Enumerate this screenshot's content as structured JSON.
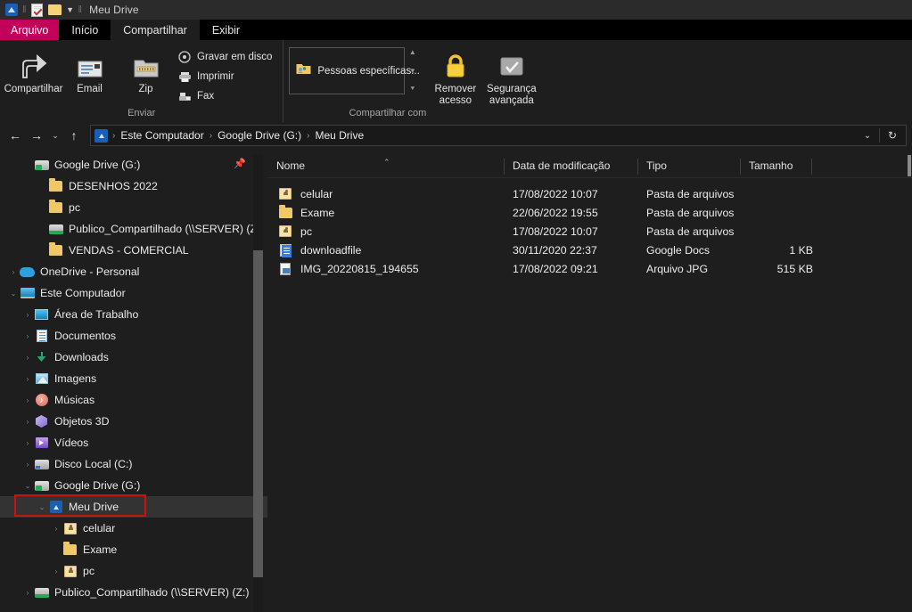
{
  "titlebar": {
    "title": "Meu Drive",
    "icons": [
      "google-drive-icon",
      "properties-icon",
      "new-folder-icon",
      "customize-chevron-icon"
    ]
  },
  "ribbon": {
    "tabs": [
      {
        "label": "Arquivo",
        "state": "file"
      },
      {
        "label": "Início",
        "state": "normal"
      },
      {
        "label": "Compartilhar",
        "state": "active"
      },
      {
        "label": "Exibir",
        "state": "normal"
      }
    ],
    "groups": [
      {
        "caption": "Enviar",
        "big_buttons": [
          {
            "label": "Compartilhar",
            "icon": "share-arrow-icon"
          },
          {
            "label": "Email",
            "icon": "email-icon"
          },
          {
            "label": "Zip",
            "icon": "zip-folder-icon"
          }
        ],
        "small_buttons": [
          {
            "label": "Gravar em disco",
            "icon": "disc-icon"
          },
          {
            "label": "Imprimir",
            "icon": "printer-icon"
          },
          {
            "label": "Fax",
            "icon": "fax-icon"
          }
        ]
      },
      {
        "caption": "Compartilhar com",
        "list_item": {
          "label": "Pessoas específicas...",
          "icon": "shared-folder-icon"
        },
        "big_buttons": [
          {
            "label": "Remover\nacesso",
            "line1": "Remover",
            "line2": "acesso",
            "icon": "lock-icon"
          },
          {
            "label": "Segurança\navançada",
            "line1": "Segurança",
            "line2": "avançada",
            "icon": "security-shield-icon"
          }
        ]
      }
    ]
  },
  "addressbar": {
    "back": "←",
    "forward": "→",
    "recent": "⌄",
    "up": "↑",
    "path_icon": "google-drive-icon",
    "crumbs": [
      "Este Computador",
      "Google Drive (G:)",
      "Meu Drive"
    ],
    "dropdown": "⌄",
    "refresh": "↻"
  },
  "sidebar": {
    "items": [
      {
        "label": "Google Drive (G:)",
        "icon": "gdrive-drive-icon",
        "indent": 1,
        "expander": "",
        "pin": true,
        "selected": false
      },
      {
        "label": "DESENHOS 2022",
        "icon": "folder-icon",
        "indent": 2,
        "expander": "",
        "selected": false
      },
      {
        "label": "pc",
        "icon": "folder-icon",
        "indent": 2,
        "expander": "",
        "selected": false
      },
      {
        "label": "Publico_Compartilhado (\\\\SERVER) (Z:)",
        "icon": "network-drive-icon",
        "indent": 2,
        "expander": "",
        "selected": false
      },
      {
        "label": "VENDAS - COMERCIAL",
        "icon": "folder-icon",
        "indent": 2,
        "expander": "",
        "selected": false
      },
      {
        "label": "OneDrive - Personal",
        "icon": "onedrive-icon",
        "indent": 0,
        "expander": "›",
        "selected": false
      },
      {
        "label": "Este Computador",
        "icon": "this-pc-icon",
        "indent": 0,
        "expander": "⌄",
        "selected": false
      },
      {
        "label": "Área de Trabalho",
        "icon": "desktop-icon",
        "indent": 1,
        "expander": "›",
        "selected": false
      },
      {
        "label": "Documentos",
        "icon": "documents-icon",
        "indent": 1,
        "expander": "›",
        "selected": false
      },
      {
        "label": "Downloads",
        "icon": "downloads-icon",
        "indent": 1,
        "expander": "›",
        "selected": false
      },
      {
        "label": "Imagens",
        "icon": "pictures-icon",
        "indent": 1,
        "expander": "›",
        "selected": false
      },
      {
        "label": "Músicas",
        "icon": "music-icon",
        "indent": 1,
        "expander": "›",
        "selected": false
      },
      {
        "label": "Objetos 3D",
        "icon": "objects3d-icon",
        "indent": 1,
        "expander": "›",
        "selected": false
      },
      {
        "label": "Vídeos",
        "icon": "videos-icon",
        "indent": 1,
        "expander": "›",
        "selected": false
      },
      {
        "label": "Disco Local (C:)",
        "icon": "harddisk-icon",
        "indent": 1,
        "expander": "›",
        "selected": false
      },
      {
        "label": "Google Drive (G:)",
        "icon": "gdrive-drive-icon",
        "indent": 1,
        "expander": "⌄",
        "selected": false
      },
      {
        "label": "Meu Drive",
        "icon": "meu-drive-icon",
        "indent": 2,
        "expander": "⌄",
        "selected": true,
        "highlight": true
      },
      {
        "label": "celular",
        "icon": "shared-folder-icon",
        "indent": 3,
        "expander": "›",
        "selected": false
      },
      {
        "label": "Exame",
        "icon": "folder-icon",
        "indent": 3,
        "expander": "",
        "selected": false
      },
      {
        "label": "pc",
        "icon": "shared-folder-icon",
        "indent": 3,
        "expander": "›",
        "selected": false
      },
      {
        "label": "Publico_Compartilhado (\\\\SERVER) (Z:)",
        "icon": "network-drive-icon",
        "indent": 1,
        "expander": "›",
        "selected": false
      }
    ]
  },
  "filelist": {
    "columns": [
      {
        "label": "Nome",
        "sorted": "asc"
      },
      {
        "label": "Data de modificação"
      },
      {
        "label": "Tipo"
      },
      {
        "label": "Tamanho"
      }
    ],
    "rows": [
      {
        "name": "celular",
        "icon": "shared-folder-icon",
        "modified": "17/08/2022 10:07",
        "type": "Pasta de arquivos",
        "size": ""
      },
      {
        "name": "Exame",
        "icon": "folder-icon",
        "modified": "22/06/2022 19:55",
        "type": "Pasta de arquivos",
        "size": ""
      },
      {
        "name": "pc",
        "icon": "shared-folder-icon",
        "modified": "17/08/2022 10:07",
        "type": "Pasta de arquivos",
        "size": ""
      },
      {
        "name": "downloadfile",
        "icon": "google-docs-icon",
        "modified": "30/11/2020 22:37",
        "type": "Google Docs",
        "size": "1 KB"
      },
      {
        "name": "IMG_20220815_194655",
        "icon": "jpg-file-icon",
        "modified": "17/08/2022 09:21",
        "type": "Arquivo JPG",
        "size": "515 KB"
      }
    ]
  },
  "colors": {
    "file_tab": "#c2015a",
    "window_bg": "#1e1e1e",
    "titlebar_bg": "#2b2b2b",
    "selection": "#333333",
    "highlight_box": "#cc1111"
  }
}
